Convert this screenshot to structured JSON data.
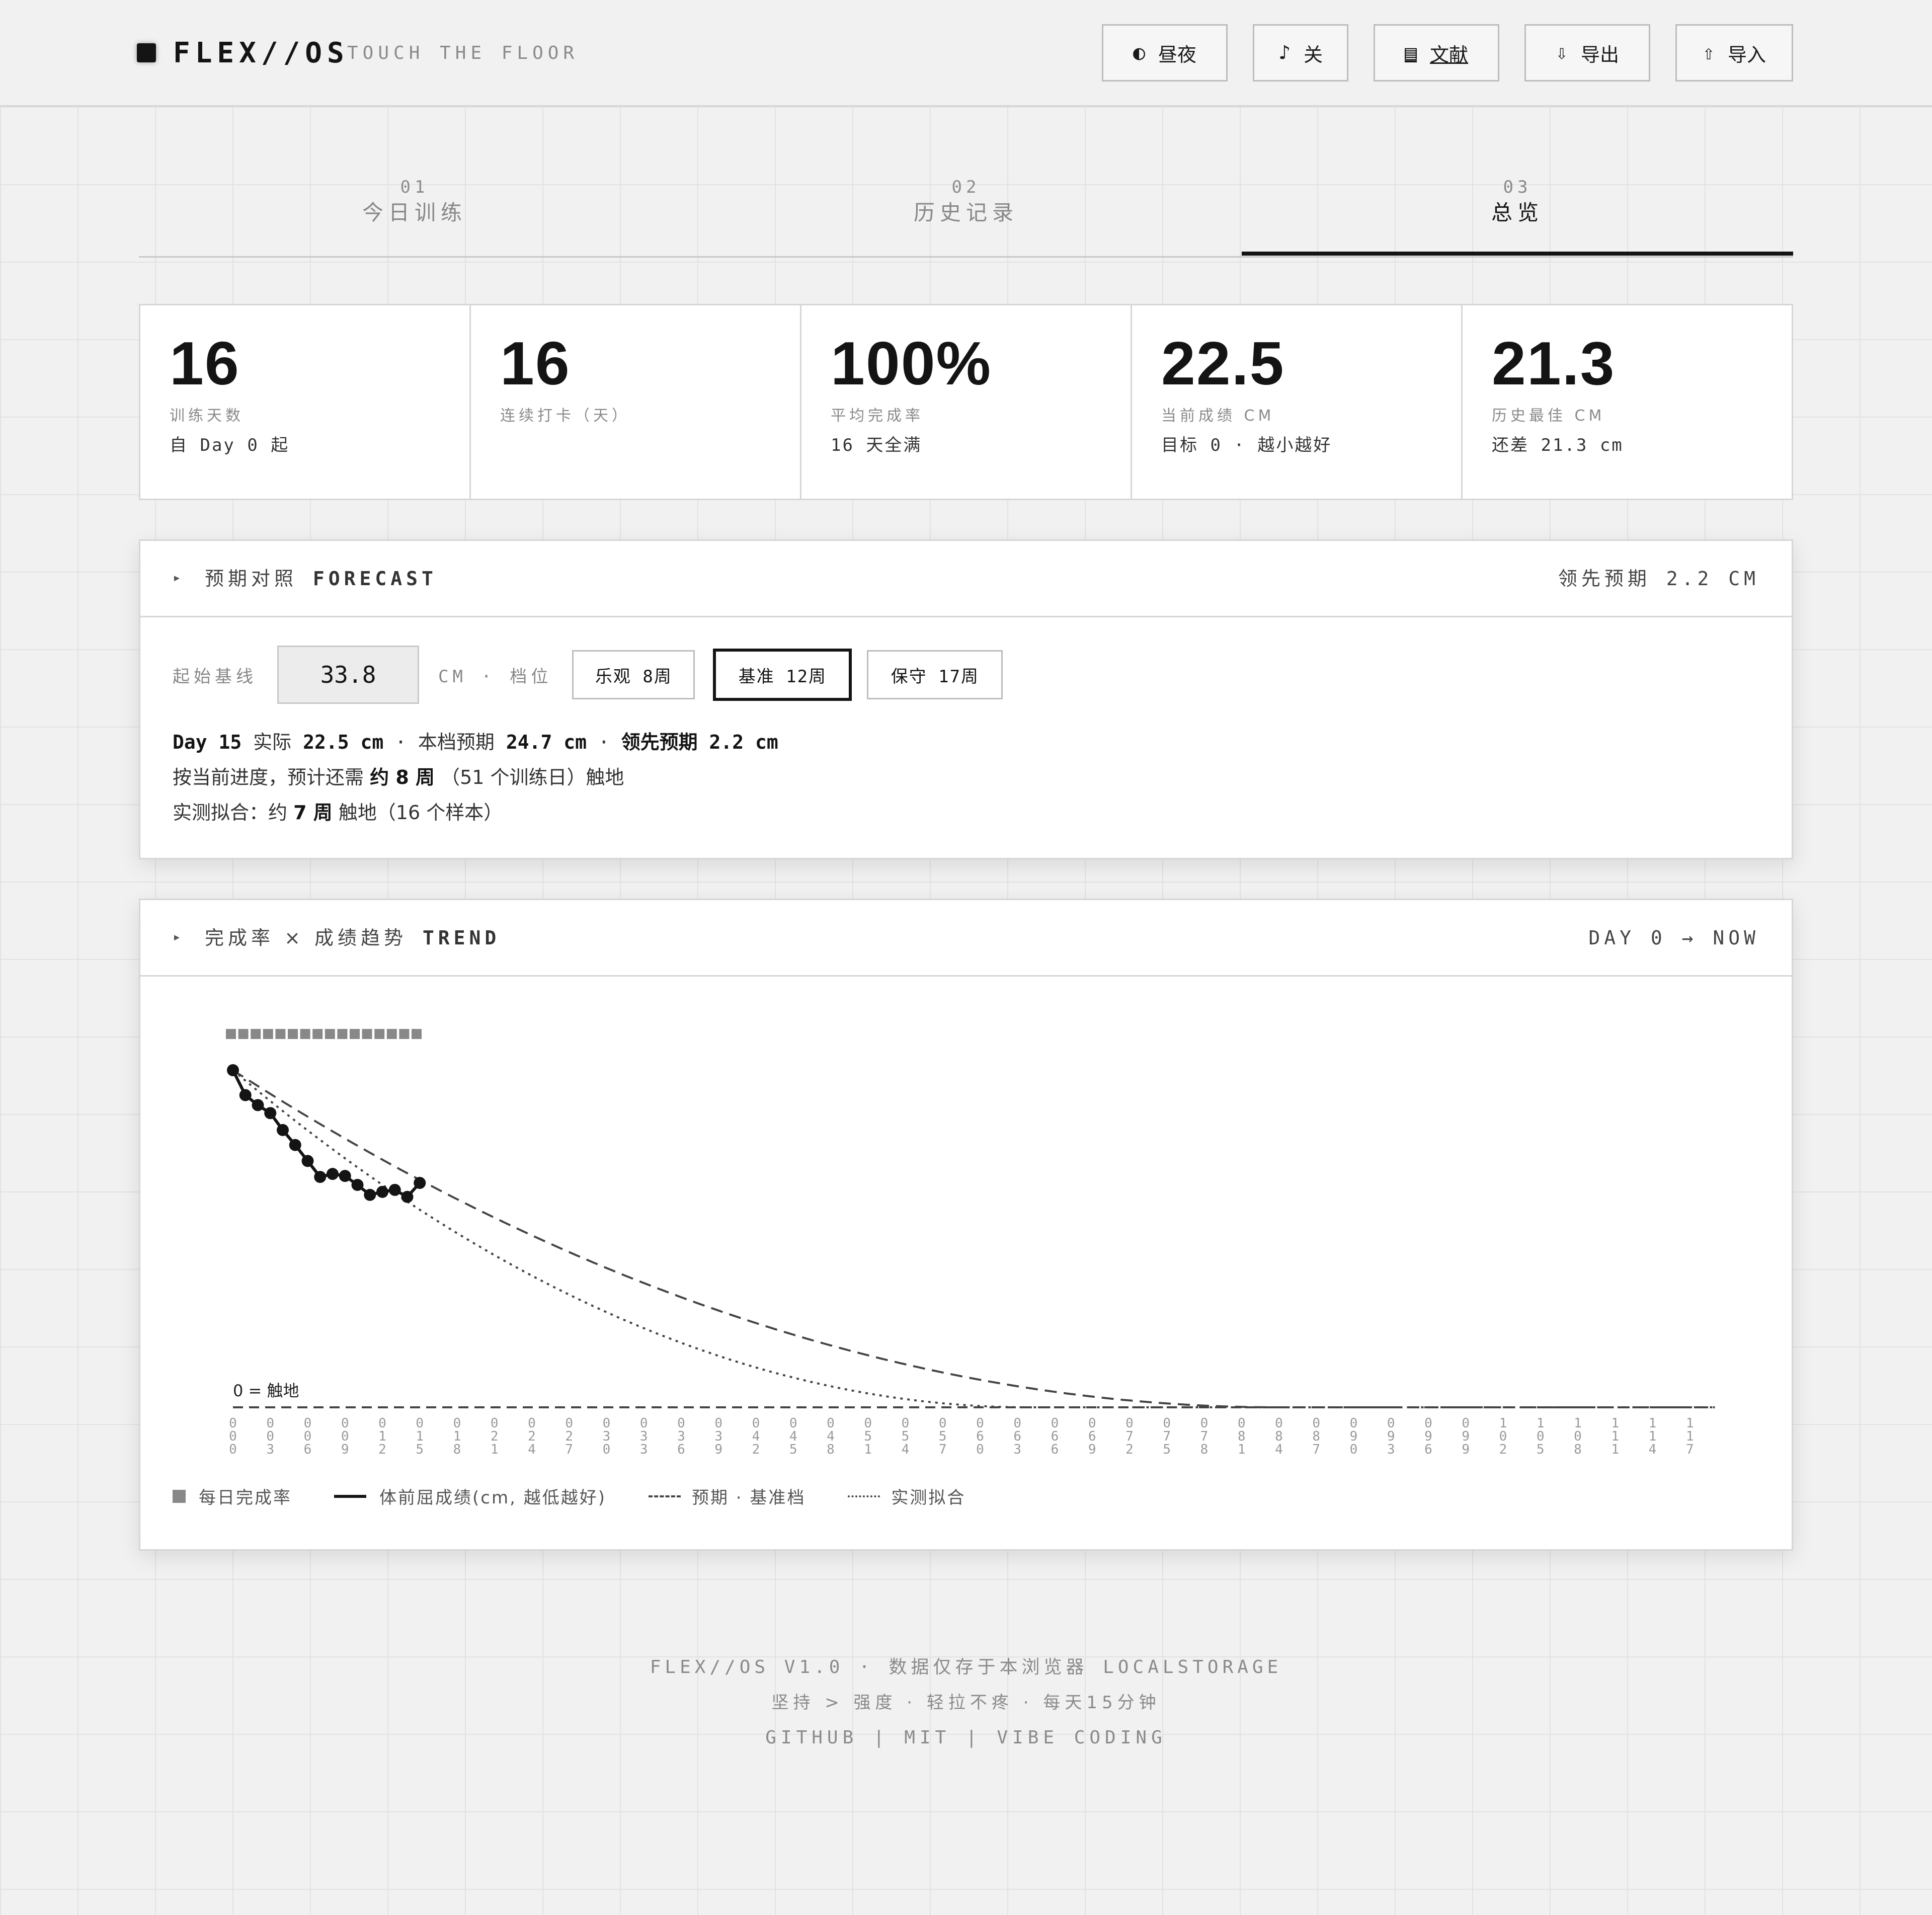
{
  "header": {
    "logo": "FLEX//OS",
    "tagline": "TOUCH THE FLOOR",
    "buttons": [
      {
        "icon": "◐",
        "label": "昼夜"
      },
      {
        "icon": "♪",
        "label": "关"
      },
      {
        "icon": "▤",
        "label": "文献"
      },
      {
        "icon": "⇩",
        "label": "导出"
      },
      {
        "icon": "⇧",
        "label": "导入"
      }
    ]
  },
  "tabs": [
    {
      "num": "01",
      "label": "今日训练"
    },
    {
      "num": "02",
      "label": "历史记录"
    },
    {
      "num": "03",
      "label": "总览"
    }
  ],
  "stats": [
    {
      "value": "16",
      "label": "训练天数",
      "sub": "自 Day 0 起"
    },
    {
      "value": "16",
      "label": "连续打卡（天）",
      "sub": ""
    },
    {
      "value": "100%",
      "label": "平均完成率",
      "sub": "16 天全满"
    },
    {
      "value": "22.5",
      "label": "当前成绩 CM",
      "sub": "目标 0 · 越小越好"
    },
    {
      "value": "21.3",
      "label": "历史最佳 CM",
      "sub": "还差 21.3 cm"
    }
  ],
  "forecast": {
    "arrow": "▸",
    "title_cn": "预期对照",
    "title_en": "FORECAST",
    "right": "领先预期 2.2 CM",
    "baseline_label": "起始基线",
    "baseline_value": "33.8",
    "unit": "CM · 档位",
    "options": [
      {
        "label": "乐观 8周",
        "selected": false
      },
      {
        "label": "基准 12周",
        "selected": true
      },
      {
        "label": "保守 17周",
        "selected": false
      }
    ],
    "line1": {
      "day": "Day 15",
      "actual_label": "实际",
      "actual": "22.5 cm",
      "sep1": "·",
      "plan_label": "本档预期",
      "plan": "24.7 cm",
      "sep2": "·",
      "lead_label": "领先预期",
      "lead": "2.2 cm"
    },
    "line2": {
      "pre": "按当前进度，预计还需",
      "mid": "约 8 周",
      "post": "（51 个训练日）触地"
    },
    "line3": {
      "pre": "实测拟合：约",
      "mid": "7 周",
      "post": "触地（16 个样本）"
    }
  },
  "trend": {
    "arrow": "▸",
    "title_cn": "完成率 × 成绩趋势",
    "title_en": "TREND",
    "right": "DAY 0 → NOW",
    "zero_label": "0 = 触地",
    "legend": {
      "completion": "每日完成率",
      "score": "体前屈成绩(cm, 越低越好)",
      "plan": "预期 · 基准档",
      "fit": "实测拟合"
    }
  },
  "chart_data": {
    "type": "line",
    "x_ticks": [
      "000",
      "003",
      "006",
      "009",
      "012",
      "015",
      "018",
      "021",
      "024",
      "027",
      "030",
      "033",
      "036",
      "039",
      "042",
      "045",
      "048",
      "051",
      "054",
      "057",
      "060",
      "063",
      "066",
      "069",
      "072",
      "075",
      "078",
      "081",
      "084",
      "087",
      "090",
      "093",
      "096",
      "099",
      "102",
      "105",
      "108",
      "111",
      "114",
      "117"
    ],
    "xlim": [
      0,
      119
    ],
    "series": [
      {
        "name": "体前屈成绩(cm, 越低越好)",
        "x": [
          0,
          1,
          2,
          3,
          4,
          5,
          6,
          7,
          8,
          9,
          10,
          11,
          12,
          13,
          14,
          15
        ],
        "values": [
          33.8,
          31.3,
          30.3,
          29.5,
          27.8,
          26.3,
          24.7,
          23.1,
          23.4,
          23.2,
          22.3,
          21.3,
          21.6,
          21.8,
          21.1,
          22.5
        ]
      },
      {
        "name": "每日完成率",
        "x": [
          0,
          1,
          2,
          3,
          4,
          5,
          6,
          7,
          8,
          9,
          10,
          11,
          12,
          13,
          14,
          15
        ],
        "values": [
          100,
          100,
          100,
          100,
          100,
          100,
          100,
          100,
          100,
          100,
          100,
          100,
          100,
          100,
          100,
          100
        ]
      },
      {
        "name": "预期 · 基准档",
        "function": "quadratic_to_zero",
        "start": 33.8,
        "end_day": 84
      },
      {
        "name": "实测拟合",
        "function": "quadratic_to_zero",
        "start": 33.8,
        "end_day": 64
      }
    ],
    "ylim": [
      0,
      33.8
    ]
  },
  "footer": {
    "line1": "FLEX//OS V1.0 · 数据仅存于本浏览器 LOCALSTORAGE",
    "line2": "坚持 > 强度 · 轻拉不疼 · 每天15分钟",
    "line3": "GITHUB | MIT | VIBE CODING"
  },
  "colors": {
    "ink": "#141414",
    "muted": "#888888",
    "panel": "#ffffff",
    "page": "#f1f1f1"
  }
}
